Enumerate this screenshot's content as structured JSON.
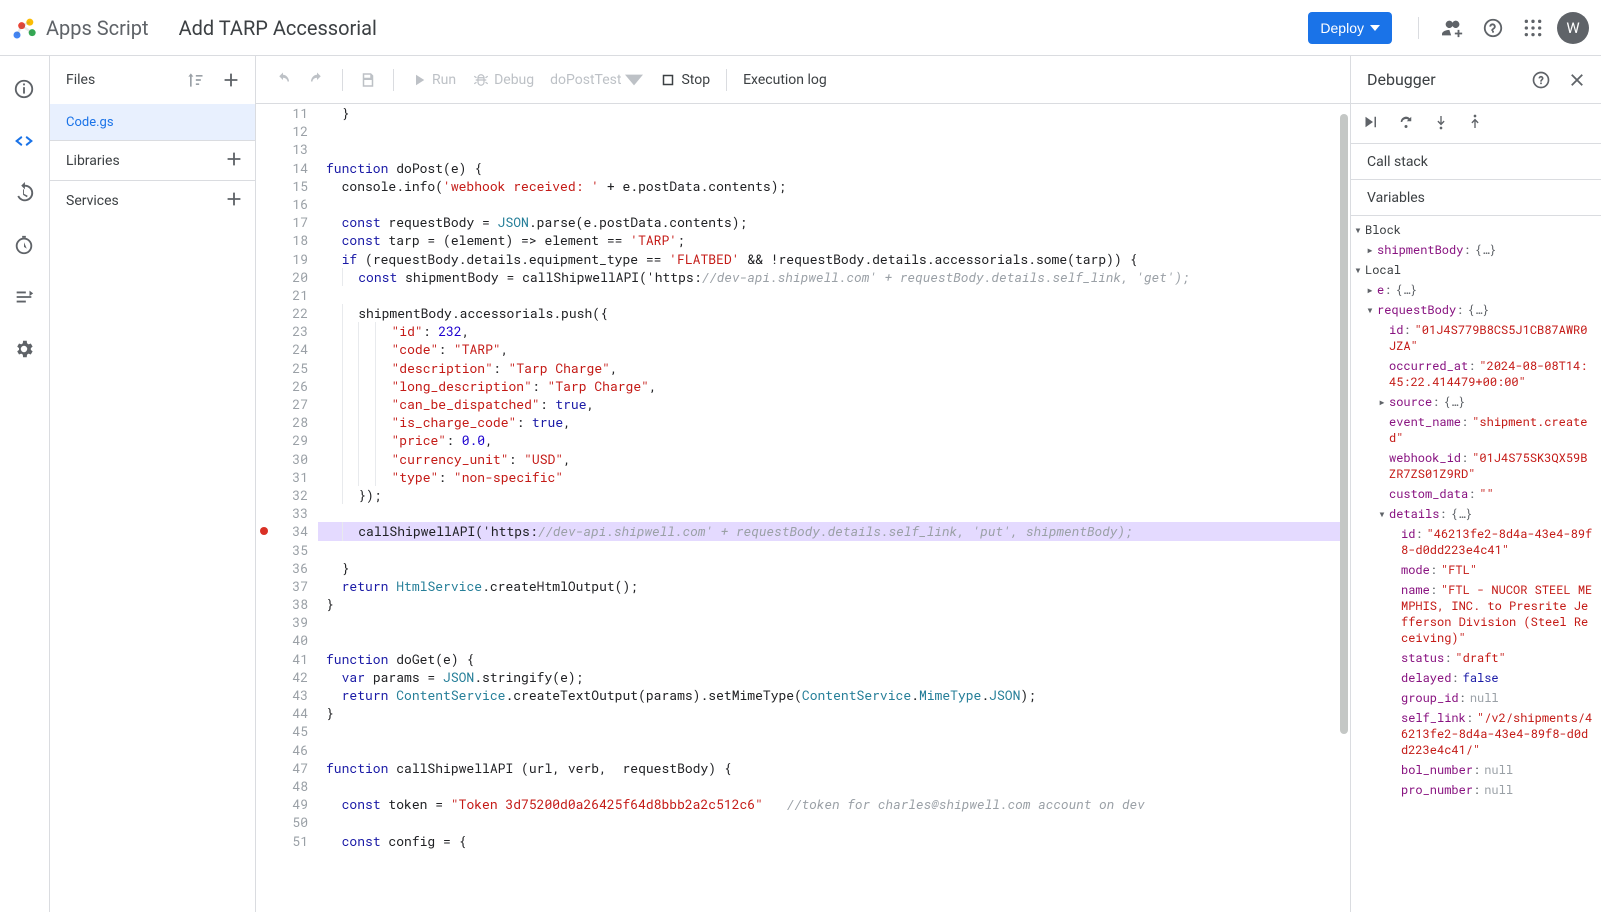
{
  "header": {
    "product": "Apps Script",
    "project_title": "Add TARP Accessorial",
    "deploy_label": "Deploy",
    "avatar_initial": "W"
  },
  "files_panel": {
    "title": "Files",
    "items": [
      "Code.gs"
    ],
    "libraries_label": "Libraries",
    "services_label": "Services"
  },
  "toolbar": {
    "run": "Run",
    "debug": "Debug",
    "func_selector": "doPostTest",
    "stop": "Stop",
    "execlog": "Execution log"
  },
  "code": {
    "first_line_no": 11,
    "breakpoint_line": 34,
    "highlight_line": 34,
    "lines_raw": [
      "  }",
      "",
      "",
      "function doPost(e) {",
      "  console.info('webhook received: ' + e.postData.contents);",
      "",
      "  const requestBody = JSON.parse(e.postData.contents);",
      "  const tarp = (element) => element == 'TARP';",
      "  if (requestBody.details.equipment_type == 'FLATBED' && !requestBody.details.accessorials.some(tarp)) {",
      "    const shipmentBody = callShipwellAPI('https://dev-api.shipwell.com' + requestBody.details.self_link, 'get');",
      "",
      "    shipmentBody.accessorials.push({",
      "        \"id\": 232,",
      "        \"code\": \"TARP\",",
      "        \"description\": \"Tarp Charge\",",
      "        \"long_description\": \"Tarp Charge\",",
      "        \"can_be_dispatched\": true,",
      "        \"is_charge_code\": true,",
      "        \"price\": 0.0,",
      "        \"currency_unit\": \"USD\",",
      "        \"type\": \"non-specific\"",
      "    });",
      "",
      "    callShipwellAPI('https://dev-api.shipwell.com' + requestBody.details.self_link, 'put', shipmentBody);",
      "",
      "  }",
      "  return HtmlService.createHtmlOutput();",
      "}",
      "",
      "",
      "function doGet(e) {",
      "  var params = JSON.stringify(e);",
      "  return ContentService.createTextOutput(params).setMimeType(ContentService.MimeType.JSON);",
      "}",
      "",
      "",
      "function callShipwellAPI (url, verb,  requestBody) {",
      "",
      "  const token = \"Token 3d75200d0a26425f64d8bbb2a2c512c6\"   //token for charles@shipwell.com account on dev",
      "",
      "  const config = {"
    ]
  },
  "debugger": {
    "title": "Debugger",
    "callstack_label": "Call stack",
    "variables_label": "Variables",
    "scopes": {
      "block_label": "Block",
      "local_label": "Local"
    },
    "block": {
      "shipmentBody": "{…}"
    },
    "local": {
      "e": "{…}",
      "requestBody": {
        "summary": "{…}",
        "id": "\"01J4S779B8CS5J1CB87AWR0JZA\"",
        "occurred_at": "\"2024-08-08T14:45:22.414479+00:00\"",
        "source": "{…}",
        "event_name": "\"shipment.created\"",
        "webhook_id": "\"01J4S75SK3QX59BZR7ZS01Z9RD\"",
        "custom_data": "\"\"",
        "details": {
          "summary": "{…}",
          "id": "\"46213fe2-8d4a-43e4-89f8-d0dd223e4c41\"",
          "mode": "\"FTL\"",
          "name": "\"FTL - NUCOR STEEL MEMPHIS, INC. to Presrite Jefferson Division (Steel Receiving)\"",
          "status": "\"draft\"",
          "delayed": "false",
          "group_id": "null",
          "self_link": "\"/v2/shipments/46213fe2-8d4a-43e4-89f8-d0dd223e4c41/\"",
          "bol_number": "null",
          "pro_number": "null"
        }
      }
    }
  }
}
